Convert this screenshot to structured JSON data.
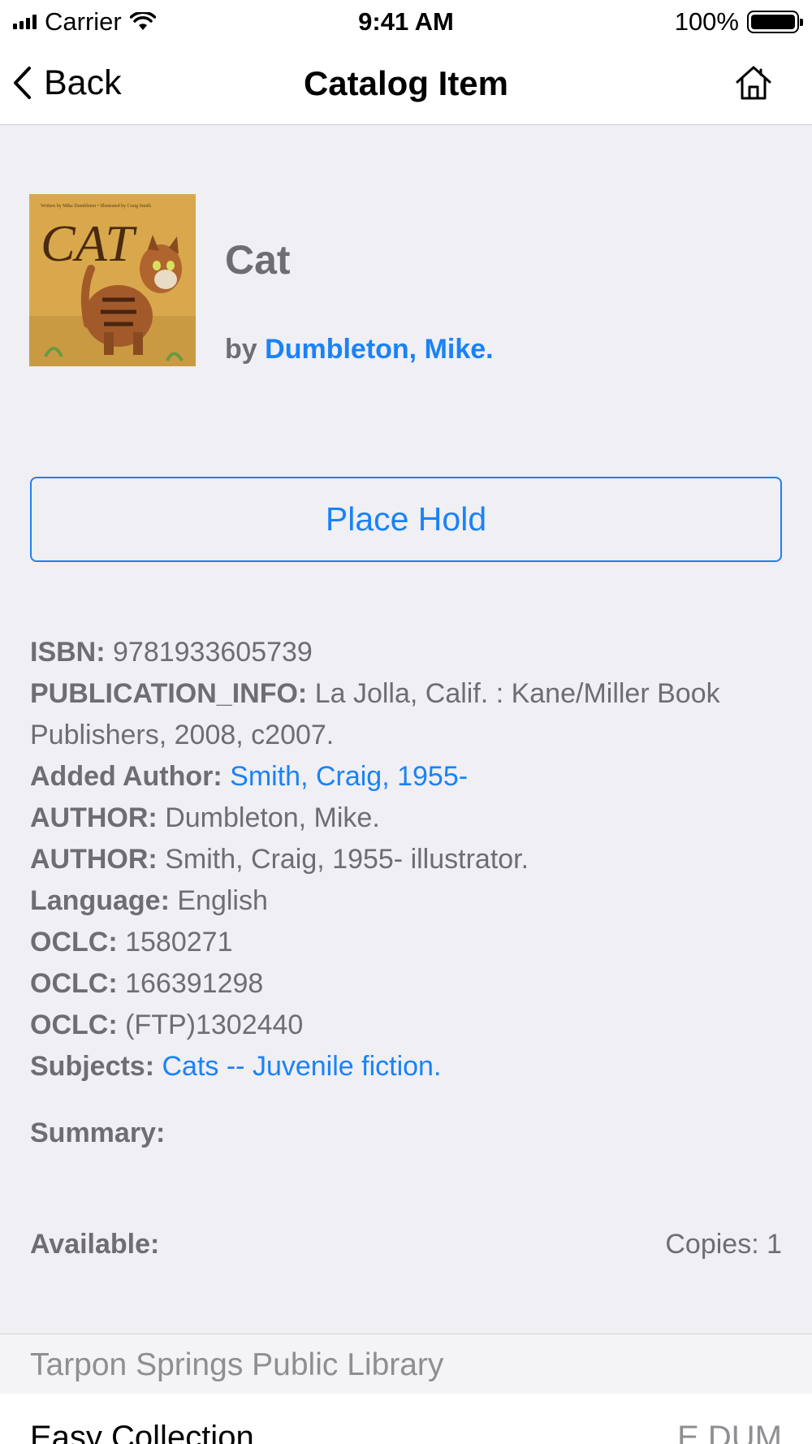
{
  "status_bar": {
    "carrier": "Carrier",
    "time": "9:41 AM",
    "battery": "100%"
  },
  "nav": {
    "back_label": "Back",
    "title": "Catalog Item",
    "home_icon": "home-icon"
  },
  "item": {
    "title": "Cat",
    "by_prefix": "by",
    "author": "Dumbleton, Mike.",
    "cover_title": "CAT",
    "cover_credit": "Written by Mike Dumbleton • Illustrated by Craig Smith"
  },
  "place_hold_label": "Place Hold",
  "details": [
    {
      "label": "ISBN:",
      "value": "9781933605739",
      "link": false
    },
    {
      "label": "PUBLICATION_INFO:",
      "value": "La Jolla, Calif. : Kane/Miller Book Publishers, 2008, c2007.",
      "link": false
    },
    {
      "label": "Added Author:",
      "value": "Smith, Craig, 1955-",
      "link": true
    },
    {
      "label": "AUTHOR:",
      "value": "Dumbleton, Mike.",
      "link": false
    },
    {
      "label": "AUTHOR:",
      "value": "Smith, Craig, 1955- illustrator.",
      "link": false
    },
    {
      "label": "Language:",
      "value": "English",
      "link": false
    },
    {
      "label": "OCLC:",
      "value": "1580271",
      "link": false
    },
    {
      "label": "OCLC:",
      "value": "166391298",
      "link": false
    },
    {
      "label": "OCLC:",
      "value": "(FTP)1302440",
      "link": false
    },
    {
      "label": "Subjects:",
      "value": "Cats -- Juvenile fiction.",
      "link": true
    }
  ],
  "summary_label": "Summary:",
  "available_label": "Available:",
  "copies": "Copies: 1",
  "library": {
    "name": "Tarpon Springs Public Library",
    "collection": "Easy Collection",
    "call_number": "E DUM"
  },
  "colors": {
    "link": "#1a82f7",
    "text": "#6d6d72",
    "background": "#efeff4"
  }
}
